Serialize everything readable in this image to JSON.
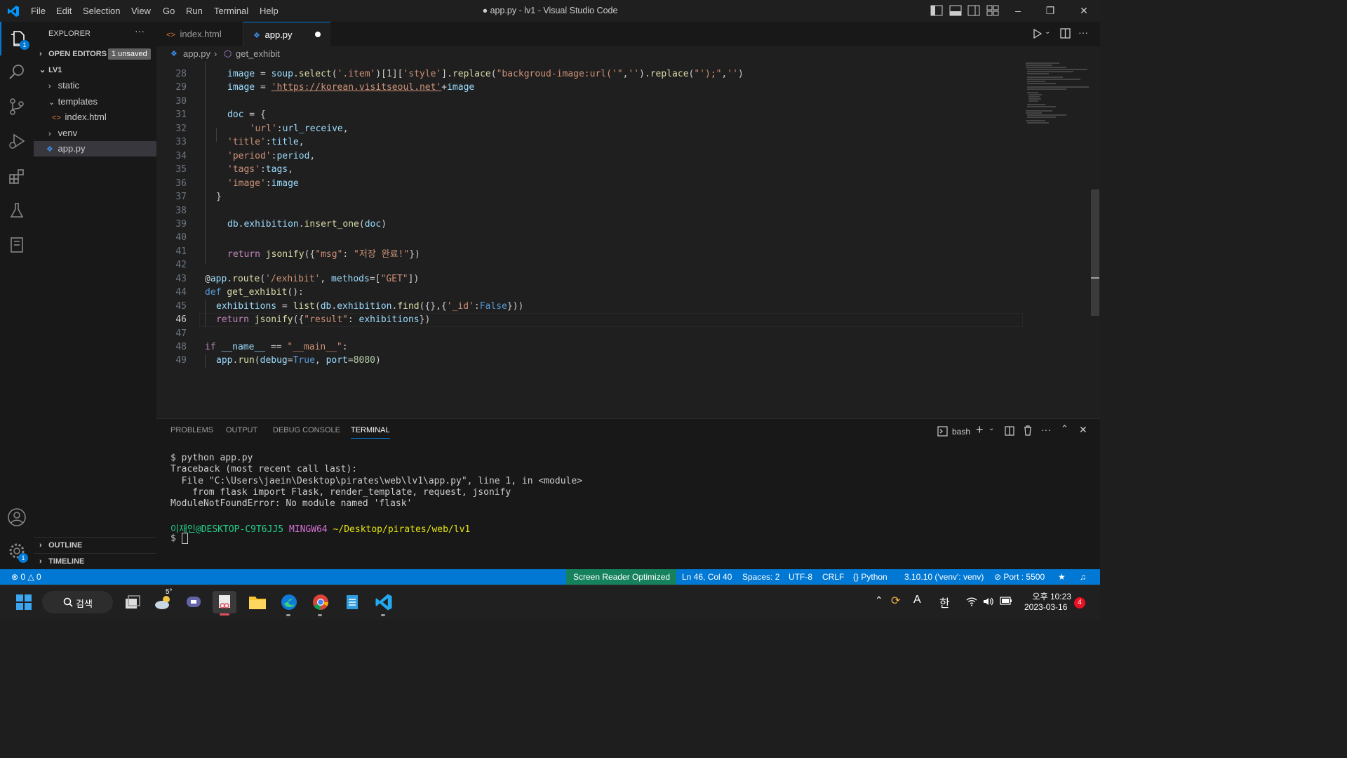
{
  "titlebar": {
    "menu": [
      "File",
      "Edit",
      "Selection",
      "View",
      "Go",
      "Run",
      "Terminal",
      "Help"
    ],
    "window_title": "● app.py - lv1 - Visual Studio Code"
  },
  "activity": {
    "explorer_badge": "1",
    "settings_badge": "1"
  },
  "sidebar": {
    "title": "EXPLORER",
    "open_editors": "OPEN EDITORS",
    "unsaved_badge": "1 unsaved",
    "folder": "LV1",
    "items": [
      "static",
      "templates",
      "index.html",
      "venv",
      "app.py"
    ],
    "outline": "OUTLINE",
    "timeline": "TIMELINE"
  },
  "tabs": [
    {
      "label": "index.html"
    },
    {
      "label": "app.py"
    }
  ],
  "breadcrumb": {
    "file": "app.py",
    "symbol": "get_exhibit"
  },
  "editor": {
    "line_numbers": [
      "28",
      "29",
      "30",
      "31",
      "32",
      "33",
      "34",
      "35",
      "36",
      "37",
      "38",
      "39",
      "40",
      "41",
      "42",
      "43",
      "44",
      "45",
      "46",
      "47",
      "48",
      "49"
    ],
    "lines": [
      "image = soup.select('.item')[1]['style'].replace(\"backgroud-image:url('\",'').replace(\"');\",'')",
      "image = 'https://korean.visitseoul.net'+image",
      "",
      "doc = {",
      "  'url':url_receive,",
      "'title':title,",
      "'period':period,",
      "'tags':tags,",
      "'image':image",
      "}",
      "",
      "db.exhibition.insert_one(doc)",
      "",
      "return jsonify({\"msg\": \"저장 완료!\"})",
      "",
      "@app.route('/exhibit', methods=[\"GET\"])",
      "def get_exhibit():",
      "exhibitions = list(db.exhibition.find({},{'_id':False}))",
      "return jsonify({\"result\": exhibitions})",
      "",
      "if __name__ == \"__main__\":",
      "app.run(debug=True, port=8080)"
    ]
  },
  "panel": {
    "tabs": [
      "PROBLEMS",
      "OUTPUT",
      "DEBUG CONSOLE",
      "TERMINAL"
    ],
    "shell": "bash",
    "terminal_lines": [
      "$ python app.py",
      "Traceback (most recent call last):",
      "  File \"C:\\Users\\jaein\\Desktop\\pirates\\web\\lv1\\app.py\", line 1, in <module>",
      "    from flask import Flask, render_template, request, jsonify",
      "ModuleNotFoundError: No module named 'flask'"
    ],
    "prompt_user": "이재인@DESKTOP-C9T6JJ5",
    "prompt_env": "MINGW64",
    "prompt_path": "~/Desktop/pirates/web/lv1",
    "prompt_symbol": "$"
  },
  "statusbar": {
    "errors": "0",
    "warnings": "0",
    "screen_reader": "Screen Reader Optimized",
    "position": "Ln 46, Col 40",
    "spaces": "Spaces: 2",
    "encoding": "UTF-8",
    "eol": "CRLF",
    "language": "Python",
    "interpreter": "3.10.10 ('venv': venv)",
    "port": "Port : 5500"
  },
  "taskbar": {
    "search": "검색",
    "weather": "5°",
    "ime_a": "A",
    "ime_han": "한",
    "time": "오후 10:23",
    "date": "2023-03-16",
    "notification_count": "4"
  },
  "colors": {
    "accent": "#0078d4",
    "statusbar": "#0078d4",
    "background": "#1f1f1f"
  }
}
